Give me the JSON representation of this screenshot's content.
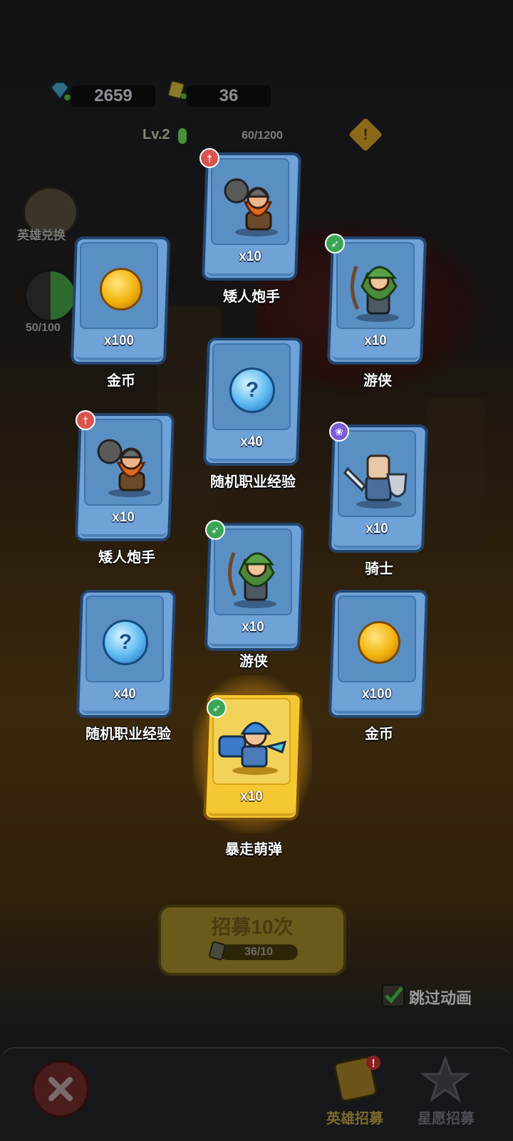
{
  "top_bar": {
    "gems": "2659",
    "tickets": "36",
    "level": "Lv.2",
    "xp": "60/1200",
    "xp_progress": 0.05,
    "warning_icon": "exclamation-icon"
  },
  "side": {
    "hero_exchange_label": "英雄兑换",
    "star_progress": "50/100"
  },
  "cards": [
    {
      "qty": "x10",
      "name": "矮人炮手",
      "class_icon": "sword-icon",
      "item": "dwarf-gunner"
    },
    {
      "qty": "x100",
      "name": "金币",
      "item": "gold-coin"
    },
    {
      "qty": "x10",
      "name": "游侠",
      "class_icon": "bow-icon",
      "item": "ranger"
    },
    {
      "qty": "x40",
      "name": "随机职业经验",
      "item": "random-class-exp-orb"
    },
    {
      "qty": "x10",
      "name": "矮人炮手",
      "class_icon": "sword-icon",
      "item": "dwarf-gunner"
    },
    {
      "qty": "x10",
      "name": "骑士",
      "class_icon": "paw-icon",
      "item": "knight"
    },
    {
      "qty": "x10",
      "name": "游侠",
      "class_icon": "bow-icon",
      "item": "ranger"
    },
    {
      "qty": "x40",
      "name": "随机职业经验",
      "item": "random-class-exp-orb"
    },
    {
      "qty": "x100",
      "name": "金币",
      "item": "gold-coin"
    },
    {
      "qty": "x10",
      "name": "暴走萌弹",
      "class_icon": "bow-icon",
      "item": "rampage-gunner",
      "rarity": "gold"
    }
  ],
  "bottom": {
    "recruit_label": "招募10次",
    "recruit_count": "36/10",
    "skip_label": "跳过动画",
    "skip_checked": true
  },
  "nav": {
    "hero_recruit": "英雄招募",
    "wish_recruit": "星愿招募"
  },
  "colors": {
    "card_blue": "#6fa2d6",
    "card_gold": "#f5c832",
    "badge_red": "#d9534f",
    "badge_green": "#3aa655",
    "badge_purple": "#7b5cd6"
  }
}
